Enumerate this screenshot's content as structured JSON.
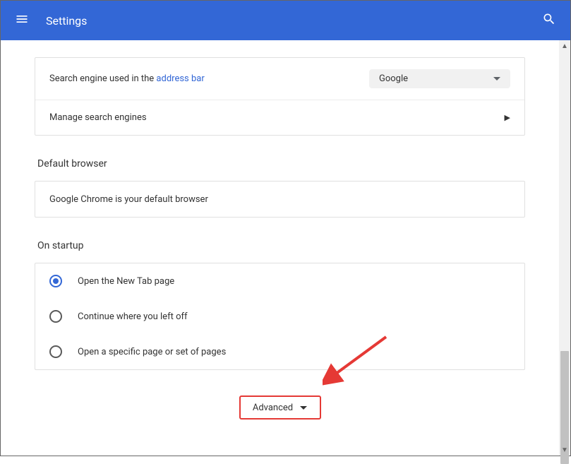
{
  "header": {
    "title": "Settings"
  },
  "searchEngine": {
    "label_prefix": "Search engine used in the ",
    "label_link": "address bar",
    "selected": "Google",
    "manage_label": "Manage search engines"
  },
  "defaultBrowser": {
    "heading": "Default browser",
    "status": "Google Chrome is your default browser"
  },
  "startup": {
    "heading": "On startup",
    "options": [
      {
        "label": "Open the New Tab page",
        "selected": true
      },
      {
        "label": "Continue where you left off",
        "selected": false
      },
      {
        "label": "Open a specific page or set of pages",
        "selected": false
      }
    ]
  },
  "advanced": {
    "label": "Advanced"
  }
}
